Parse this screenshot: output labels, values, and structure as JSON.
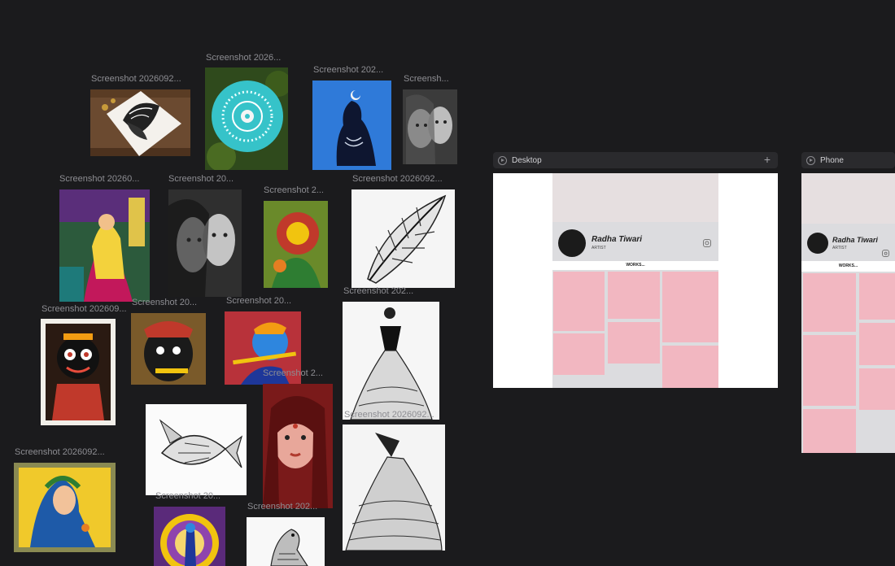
{
  "canvas": {
    "background": "#1b1b1d",
    "labels": [
      "Screenshot 2026092...",
      "Screenshot 2026...",
      "Screenshot 202...",
      "Screensh...",
      "Screenshot 20260...",
      "Screenshot 20...",
      "Screenshot 2...",
      "Screenshot 2026092...",
      "Screenshot 202609...",
      "Screenshot 20...",
      "Screenshot 20...",
      "Screenshot 202...",
      "Screenshot 2...",
      "Screenshot 2026092...",
      "Screenshot 2026092...",
      "Screenshot 20...",
      "Screenshot 202..."
    ]
  },
  "frames": {
    "desktop": {
      "title": "Desktop",
      "add_icon": "plus-icon"
    },
    "phone": {
      "title": "Phone"
    }
  },
  "profile": {
    "name": "Radha Tiwari",
    "role": "ARTIST",
    "section": "WORKS...",
    "tile_color": "#f2b7c1",
    "social_icon": "instagram-icon"
  }
}
